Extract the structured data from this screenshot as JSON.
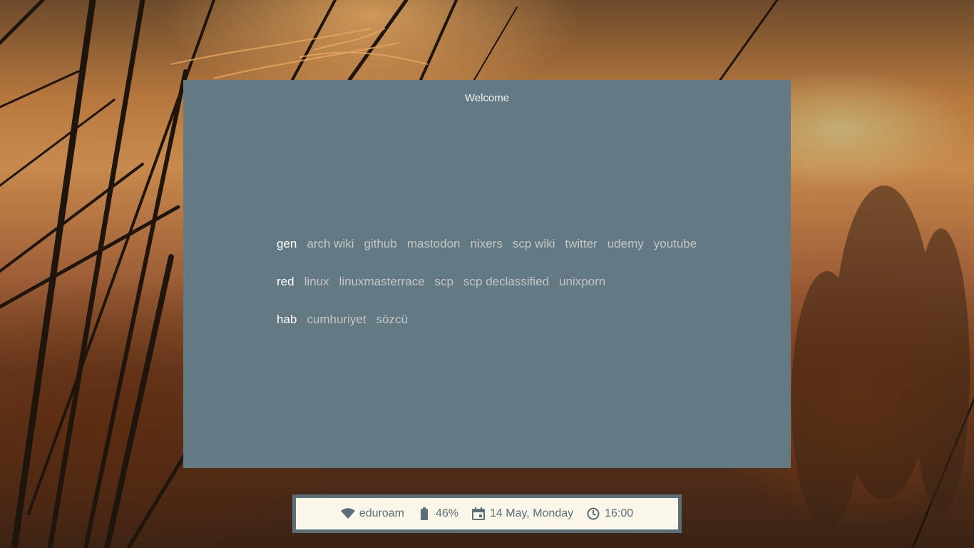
{
  "window": {
    "title": "Welcome"
  },
  "bookmarks": {
    "rows": [
      {
        "category": "gen",
        "links": [
          "arch wiki",
          "github",
          "mastodon",
          "nixers",
          "scp wiki",
          "twitter",
          "udemy",
          "youtube"
        ]
      },
      {
        "category": "red",
        "links": [
          "linux",
          "linuxmasterrace",
          "scp",
          "scp declassified",
          "unixporn"
        ]
      },
      {
        "category": "hab",
        "links": [
          "cumhuriyet",
          "sözcü"
        ]
      }
    ]
  },
  "statusbar": {
    "wifi": {
      "icon": "wifi-icon",
      "label": "eduroam"
    },
    "battery": {
      "icon": "battery-icon",
      "label": "46%"
    },
    "date": {
      "icon": "calendar-icon",
      "label": "14 May, Monday"
    },
    "time": {
      "icon": "clock-icon",
      "label": "16:00"
    }
  },
  "colors": {
    "window_bg": "#637983",
    "statusbar_border": "#5b6f79",
    "statusbar_bg": "#fbf7e9",
    "category_text": "#ffffff",
    "link_text": "#c3c6c2"
  }
}
